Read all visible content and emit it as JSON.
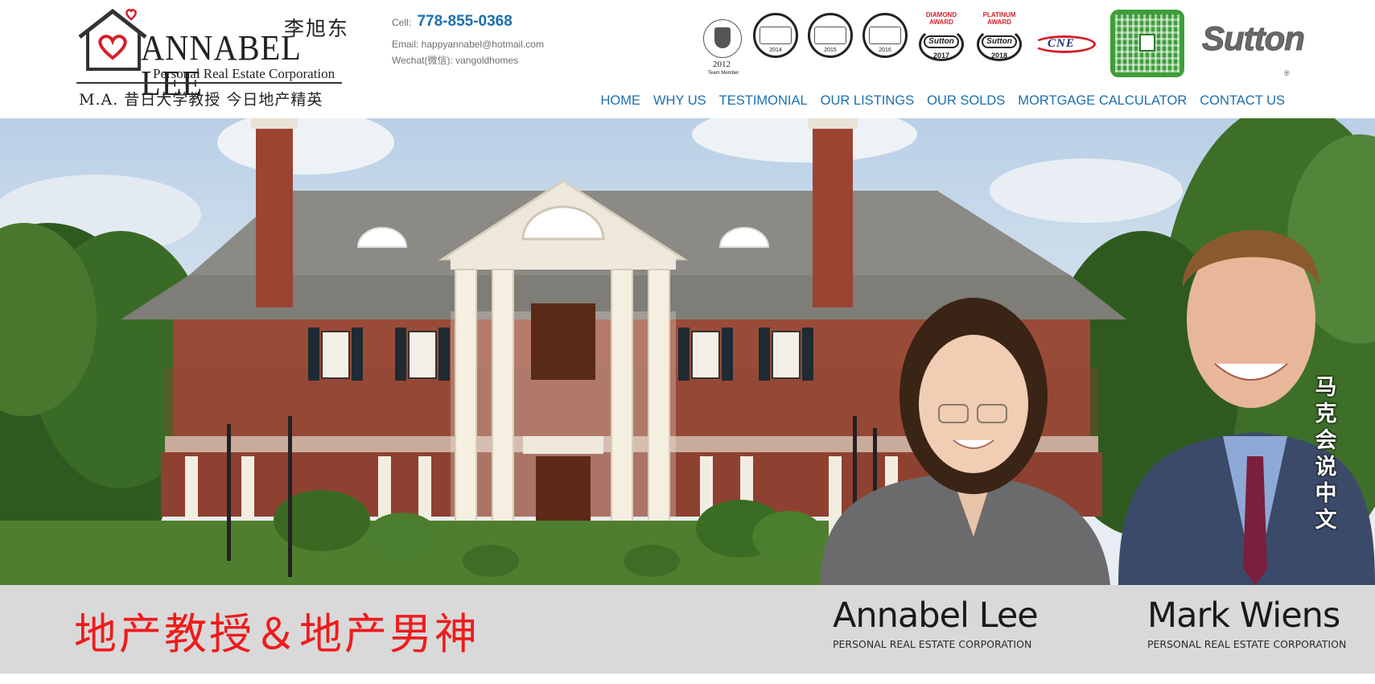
{
  "logo": {
    "cn_name": "李旭东",
    "name": "ANNABEL LEE",
    "subtitle": "Personal Real Estate Corporation",
    "tagline": "M.A. 昔日大学教授 今日地产精英"
  },
  "contact": {
    "cell_label": "Cell:",
    "cell_value": "778-855-0368",
    "email": "Email: happyannabel@hotmail.com",
    "wechat": "Wechat(微信): vangoldhomes"
  },
  "badges": {
    "medallion_year": "2012",
    "medallion_sub": "Team Member",
    "award_years": [
      "2014",
      "2015",
      "2016"
    ],
    "diamond_title": "DIAMOND AWARD",
    "diamond_year": "2017",
    "platinum_title": "PLATINUM AWARD",
    "platinum_year": "2018",
    "sutton_mark": "Sutton",
    "cne": "CNE",
    "sutton_logo": "Sutton"
  },
  "nav": {
    "items": [
      "HOME",
      "WHY US",
      "TESTIMONIAL",
      "OUR LISTINGS",
      "OUR SOLDS",
      "MORTGAGE CALCULATOR",
      "CONTACT US"
    ]
  },
  "hero": {
    "vertical_tag": "马克会说中文"
  },
  "namebar": {
    "slogan": "地产教授＆地产男神",
    "agents": [
      {
        "name": "Annabel Lee",
        "title": "PERSONAL REAL ESTATE CORPORATION"
      },
      {
        "name": "Mark Wiens",
        "title": "PERSONAL REAL ESTATE CORPORATION"
      }
    ]
  },
  "colors": {
    "nav_link": "#1b6fae",
    "slogan": "#ee1c1c",
    "namebar_bg": "#d9d9d9"
  }
}
